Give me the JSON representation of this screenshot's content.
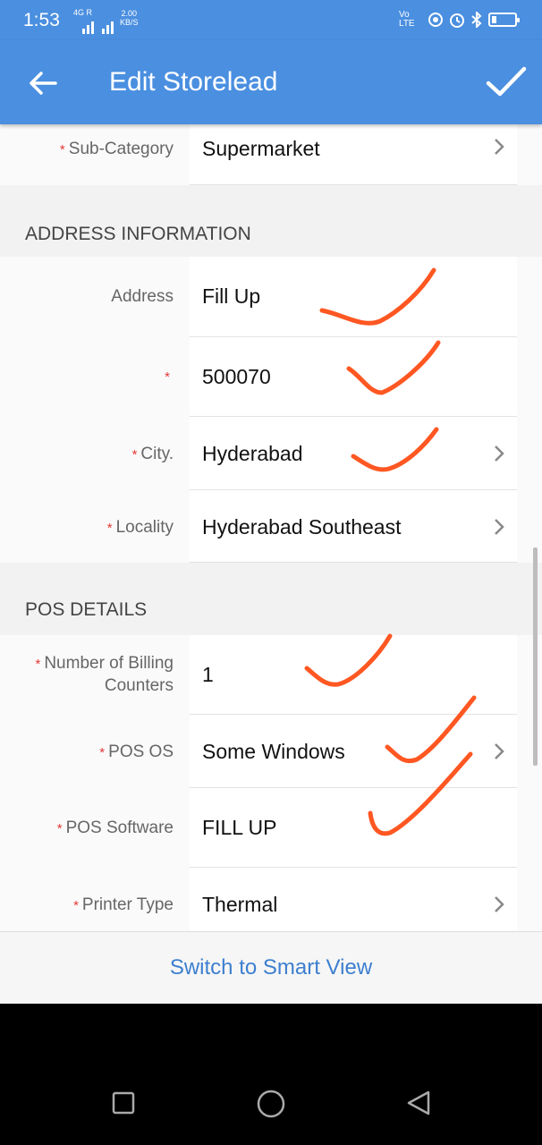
{
  "status_bar": {
    "time": "1:53",
    "network": "4G R",
    "speed_value": "2.00",
    "speed_unit": "KB/S",
    "right_label": "Vo LTE",
    "battery_level": 0.2
  },
  "app_bar": {
    "title": "Edit Storelead",
    "back_icon": "arrow-left-icon",
    "confirm_icon": "check-icon"
  },
  "fields": {
    "sub_category": {
      "label": "Sub-Category",
      "value": "Supermarket"
    }
  },
  "address_section": {
    "title": "ADDRESS INFORMATION",
    "address": {
      "label": "Address",
      "value": "Fill Up"
    },
    "pincode": {
      "label": "",
      "value": "500070"
    },
    "city": {
      "label": "City.",
      "value": "Hyderabad"
    },
    "locality": {
      "label": "Locality",
      "value": "Hyderabad Southeast"
    }
  },
  "pos_section": {
    "title": "POS DETAILS",
    "billing_counters": {
      "label_line1": "Number of Billing",
      "label_line2": "Counters",
      "value": "1"
    },
    "pos_os": {
      "label": "POS OS",
      "value": "Some Windows"
    },
    "pos_software": {
      "label": "POS Software",
      "value": "FILL UP"
    },
    "printer_type": {
      "label": "Printer Type",
      "value": "Thermal"
    }
  },
  "required_marker": "*",
  "footer": {
    "link_label": "Switch to Smart View"
  },
  "colors": {
    "primary": "#4a8fe0",
    "required": "#e53935",
    "annotation": "#ff5722",
    "link": "#3d7fcf"
  }
}
